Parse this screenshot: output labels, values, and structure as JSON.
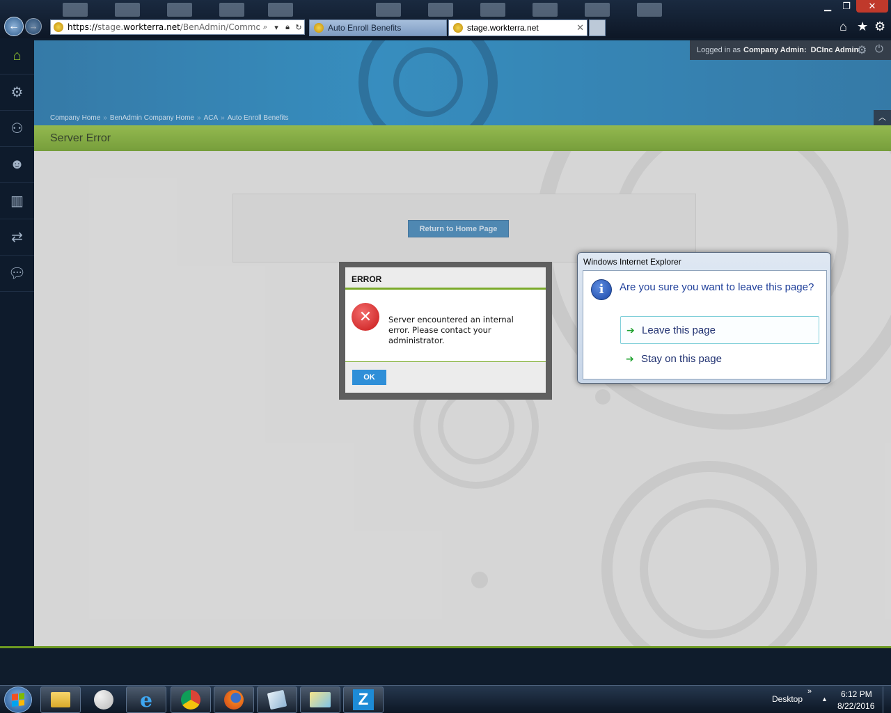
{
  "browser": {
    "url_prefix": "https://",
    "url_host_dim": "stage.",
    "url_host": "workterra.net",
    "url_path": "/BenAdmin/Common/Vi",
    "tabs": [
      {
        "label": "Auto Enroll Benefits"
      },
      {
        "label": "stage.workterra.net"
      }
    ],
    "window_controls": {
      "minimize": "▁",
      "maximize": "❐",
      "close": "✕"
    }
  },
  "header": {
    "logged_in_prefix": "Logged in as",
    "user_role": "Company Admin:",
    "user_name": "DCInc Admin"
  },
  "breadcrumb": [
    {
      "label": "Company Home"
    },
    {
      "label": "BenAdmin Company Home"
    },
    {
      "label": "ACA"
    },
    {
      "label": "Auto Enroll Benefits"
    }
  ],
  "page": {
    "title": "Server Error",
    "return_button": "Return to Home Page"
  },
  "error_modal": {
    "title": "ERROR",
    "message": "Server encountered an internal error. Please contact your administrator.",
    "ok_label": "OK"
  },
  "ie_dialog": {
    "title": "Windows Internet Explorer",
    "question": "Are you sure you want to leave this page?",
    "leave_label": "Leave this page",
    "stay_label": "Stay on this page"
  },
  "taskbar": {
    "desktop_label": "Desktop",
    "time": "6:12 PM",
    "date": "8/22/2016",
    "z_app_label": "Z"
  },
  "colors": {
    "accent_green": "#7aaa2a",
    "header_blue": "#1d86c2",
    "ok_blue": "#2f8fd8",
    "error_red": "#c81818"
  }
}
